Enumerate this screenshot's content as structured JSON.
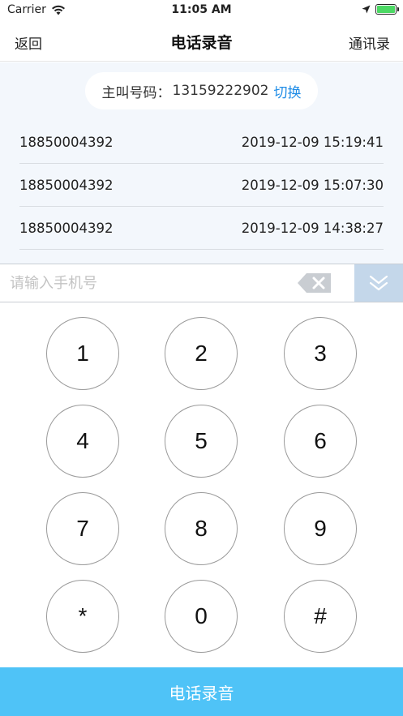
{
  "status_bar": {
    "carrier": "Carrier",
    "time": "11:05 AM"
  },
  "nav": {
    "back_label": "返回",
    "title": "电话录音",
    "contacts_label": "通讯录"
  },
  "caller": {
    "label": "主叫号码：",
    "number": "13159222902",
    "switch_label": "切换"
  },
  "records": [
    {
      "phone": "18850004392",
      "time": "2019-12-09 15:19:41"
    },
    {
      "phone": "18850004392",
      "time": "2019-12-09 15:07:30"
    },
    {
      "phone": "18850004392",
      "time": "2019-12-09 14:38:27"
    }
  ],
  "input": {
    "placeholder": "请输入手机号",
    "value": ""
  },
  "keypad": {
    "keys": [
      "1",
      "2",
      "3",
      "4",
      "5",
      "6",
      "7",
      "8",
      "9",
      "*",
      "0",
      "#"
    ]
  },
  "action": {
    "record_label": "电话录音"
  },
  "colors": {
    "accent": "#4fc3f7",
    "link": "#1f8ce6",
    "collapse_bg": "#c4d7ea",
    "records_bg": "#f3f7fc"
  }
}
